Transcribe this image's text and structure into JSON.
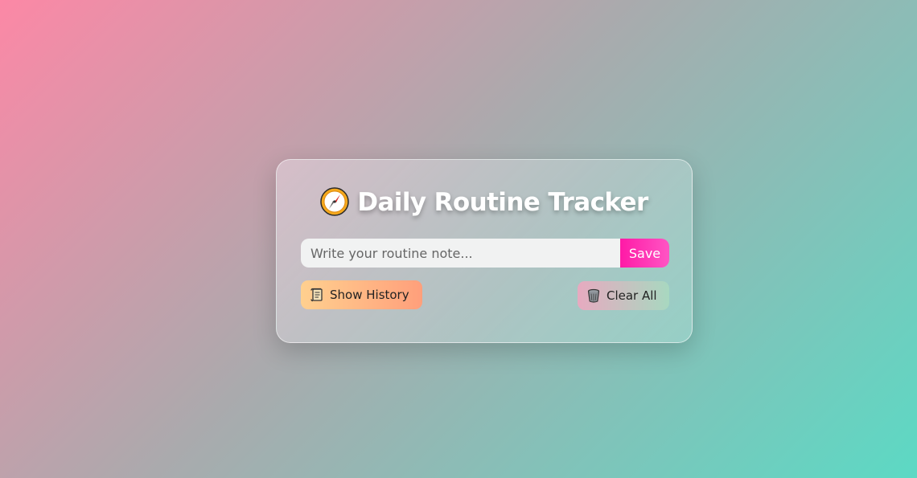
{
  "app": {
    "title": "Daily Routine Tracker",
    "title_icon": "compass-icon"
  },
  "note_form": {
    "input_placeholder": "Write your routine note...",
    "input_value": "",
    "save_label": "Save"
  },
  "actions": {
    "show_history_label": "Show History",
    "show_history_icon": "scroll-icon",
    "clear_all_label": "Clear All",
    "clear_all_icon": "wastebasket-icon"
  },
  "colors": {
    "background_start": "#fc88a6",
    "background_end": "#5cd9c4",
    "save_accent": "#ff1aa6",
    "history_button_start": "#ffd08f",
    "history_button_end": "#ff9f7b"
  }
}
